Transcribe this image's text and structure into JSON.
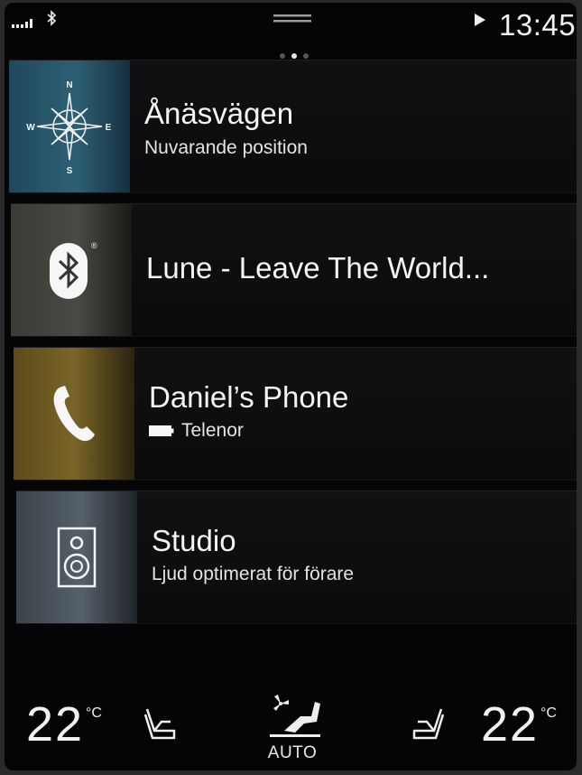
{
  "status_bar": {
    "clock": "13:45"
  },
  "tiles": [
    {
      "title": "Ånäsvägen",
      "subtitle": "Nuvarande position",
      "icon": "compass-icon",
      "compass": {
        "n": "N",
        "e": "E",
        "s": "S",
        "w": "W"
      },
      "color": "#2e6075"
    },
    {
      "title": "Lune - Leave The World...",
      "icon": "bluetooth-icon",
      "color": "#4a4a44"
    },
    {
      "title": "Daniel’s Phone",
      "subtitle": "Telenor",
      "icon": "phone-icon",
      "color": "#7a6527"
    },
    {
      "title": "Studio",
      "subtitle": "Ljud optimerat för förare",
      "icon": "speaker-icon",
      "color": "#556069"
    }
  ],
  "climate": {
    "driver_temp": "22",
    "passenger_temp": "22",
    "unit": "°C",
    "auto_label": "AUTO"
  }
}
